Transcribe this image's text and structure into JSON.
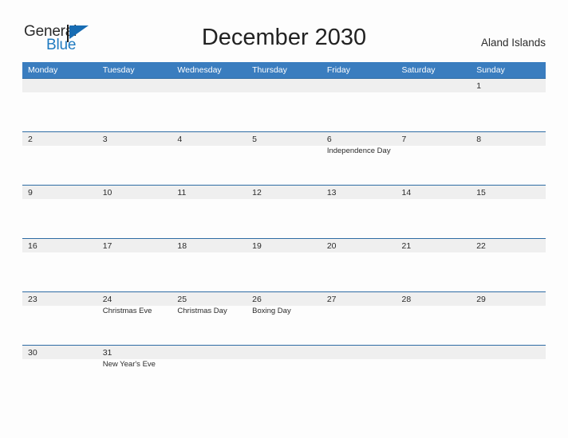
{
  "brand": {
    "word_one": "General",
    "word_two": "Blue",
    "flag_icon": "flag-triangle-icon",
    "accent_color": "#176cb3",
    "text_color": "#2b2b2b"
  },
  "header": {
    "title": "December 2030",
    "location": "Aland Islands"
  },
  "theme": {
    "header_blue": "#3a7dbf",
    "row_line_blue": "#2e6ca4",
    "band_gray": "#efefef",
    "page_background": "#fdfdfd"
  },
  "calendar": {
    "weekday_headers": [
      "Monday",
      "Tuesday",
      "Wednesday",
      "Thursday",
      "Friday",
      "Saturday",
      "Sunday"
    ],
    "weeks": [
      [
        {
          "day": "",
          "event": ""
        },
        {
          "day": "",
          "event": ""
        },
        {
          "day": "",
          "event": ""
        },
        {
          "day": "",
          "event": ""
        },
        {
          "day": "",
          "event": ""
        },
        {
          "day": "",
          "event": ""
        },
        {
          "day": "1",
          "event": ""
        }
      ],
      [
        {
          "day": "2",
          "event": ""
        },
        {
          "day": "3",
          "event": ""
        },
        {
          "day": "4",
          "event": ""
        },
        {
          "day": "5",
          "event": ""
        },
        {
          "day": "6",
          "event": "Independence Day"
        },
        {
          "day": "7",
          "event": ""
        },
        {
          "day": "8",
          "event": ""
        }
      ],
      [
        {
          "day": "9",
          "event": ""
        },
        {
          "day": "10",
          "event": ""
        },
        {
          "day": "11",
          "event": ""
        },
        {
          "day": "12",
          "event": ""
        },
        {
          "day": "13",
          "event": ""
        },
        {
          "day": "14",
          "event": ""
        },
        {
          "day": "15",
          "event": ""
        }
      ],
      [
        {
          "day": "16",
          "event": ""
        },
        {
          "day": "17",
          "event": ""
        },
        {
          "day": "18",
          "event": ""
        },
        {
          "day": "19",
          "event": ""
        },
        {
          "day": "20",
          "event": ""
        },
        {
          "day": "21",
          "event": ""
        },
        {
          "day": "22",
          "event": ""
        }
      ],
      [
        {
          "day": "23",
          "event": ""
        },
        {
          "day": "24",
          "event": "Christmas Eve"
        },
        {
          "day": "25",
          "event": "Christmas Day"
        },
        {
          "day": "26",
          "event": "Boxing Day"
        },
        {
          "day": "27",
          "event": ""
        },
        {
          "day": "28",
          "event": ""
        },
        {
          "day": "29",
          "event": ""
        }
      ],
      [
        {
          "day": "30",
          "event": ""
        },
        {
          "day": "31",
          "event": "New Year's Eve"
        },
        {
          "day": "",
          "event": ""
        },
        {
          "day": "",
          "event": ""
        },
        {
          "day": "",
          "event": ""
        },
        {
          "day": "",
          "event": ""
        },
        {
          "day": "",
          "event": ""
        }
      ]
    ]
  }
}
